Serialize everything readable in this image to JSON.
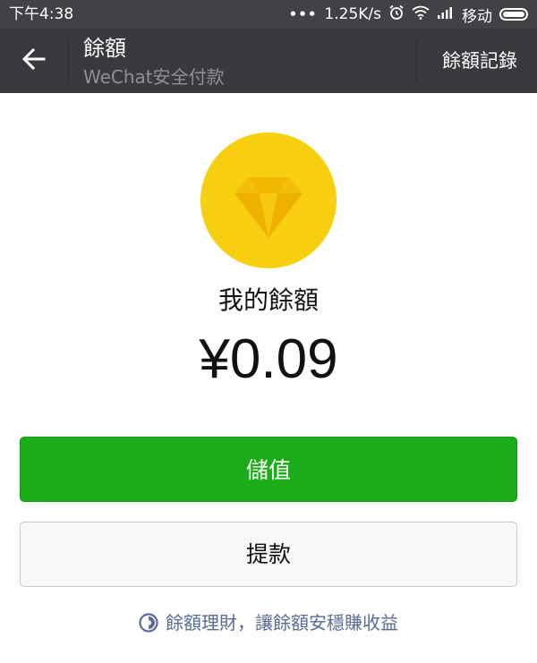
{
  "status_bar": {
    "time": "下午4:38",
    "dots": "•••",
    "speed": "1.25K/s",
    "carrier": "移动",
    "icons": [
      "alarm-icon",
      "wifi-icon",
      "signal-icon",
      "battery-icon"
    ]
  },
  "header": {
    "title": "餘額",
    "subtitle": "WeChat安全付款",
    "history_link": "餘額記錄",
    "back_icon": "back-arrow-icon"
  },
  "main": {
    "coin_icon": "diamond-coin-icon",
    "balance_label": "我的餘額",
    "balance_amount": "¥0.09",
    "topup_button": "儲值",
    "withdraw_button": "提款",
    "wealth_link": "餘額理財，讓餘額安穩賺收益",
    "wealth_icon": "wealth-management-icon"
  },
  "colors": {
    "header_bg": "#393a3f",
    "status_bg": "#414146",
    "primary_green": "#1aad19",
    "coin_yellow": "#f8cf0f",
    "link_blue": "#576b95"
  }
}
